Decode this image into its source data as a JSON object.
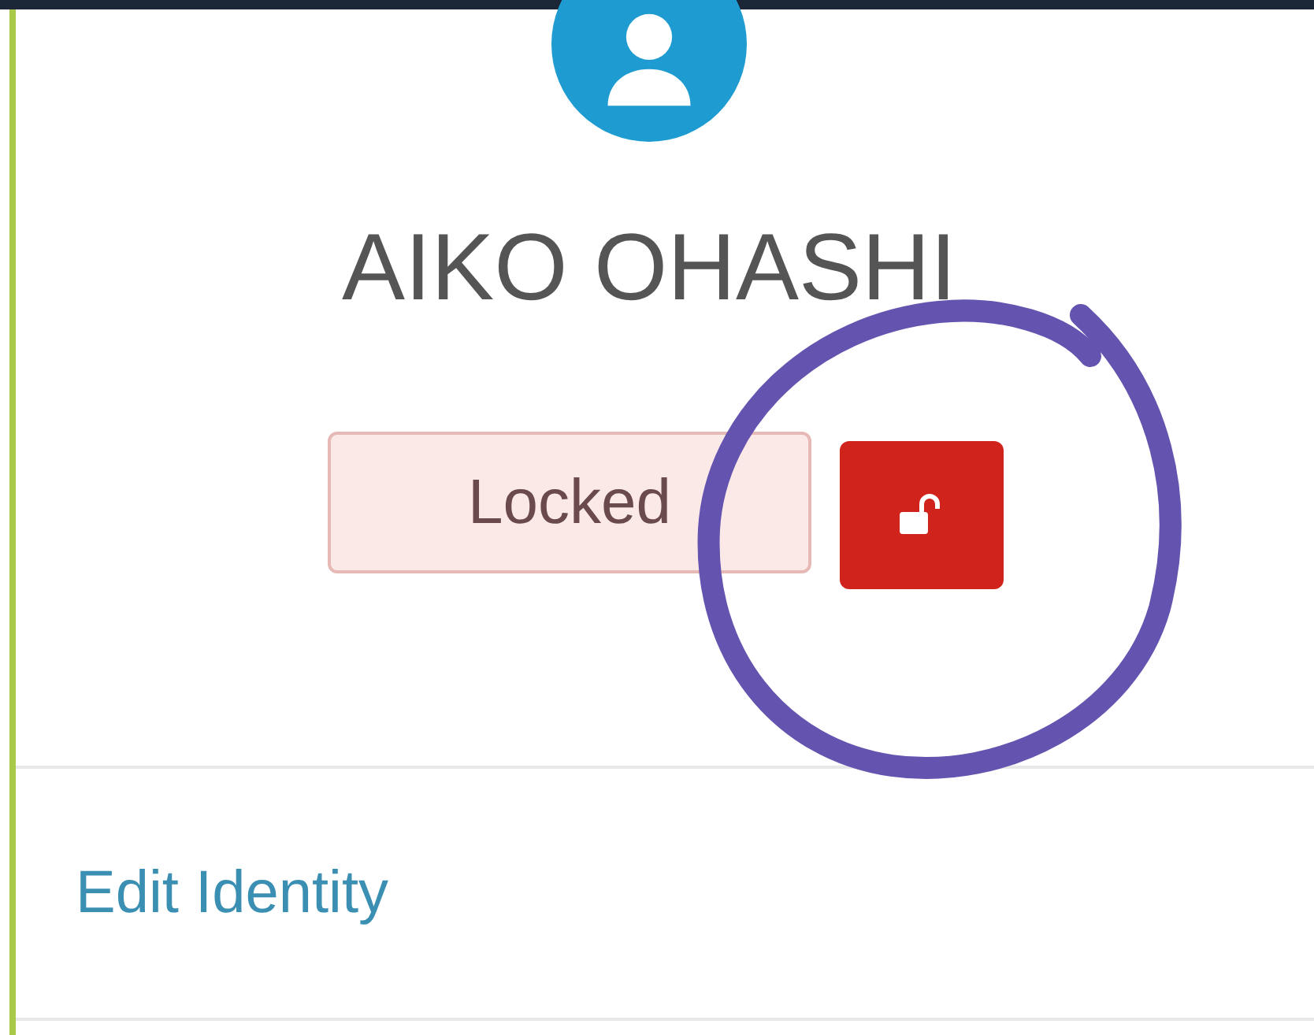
{
  "profile": {
    "name": "AIKO OHASHI",
    "status_label": "Locked"
  },
  "actions": [
    {
      "label": "Edit Identity"
    }
  ]
}
